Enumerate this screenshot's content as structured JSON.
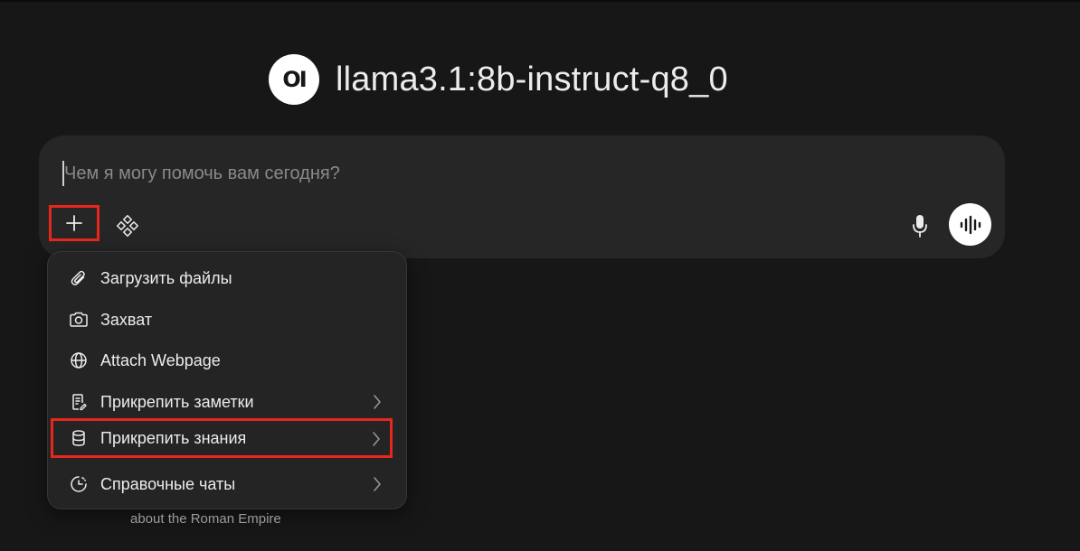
{
  "header": {
    "logo_text": "OI",
    "model_name": "llama3.1:8b-instruct-q8_0"
  },
  "composer": {
    "placeholder": "Чем я могу помочь вам сегодня?",
    "value": ""
  },
  "attach_menu": {
    "items": [
      {
        "label": "Загрузить файлы",
        "icon": "paperclip-icon",
        "has_submenu": false
      },
      {
        "label": "Захват",
        "icon": "camera-icon",
        "has_submenu": false
      },
      {
        "label": "Attach Webpage",
        "icon": "globe-icon",
        "has_submenu": false
      },
      {
        "label": "Прикрепить заметки",
        "icon": "note-icon",
        "has_submenu": true
      },
      {
        "label": "Прикрепить знания",
        "icon": "database-icon",
        "has_submenu": true,
        "highlighted": true
      },
      {
        "label": "Справочные чаты",
        "icon": "history-icon",
        "has_submenu": true
      }
    ]
  },
  "suggestion": {
    "text": "about the Roman Empire"
  },
  "colors": {
    "background": "#171717",
    "composer": "#262626",
    "menu": "#242424",
    "highlight": "#e8271c"
  }
}
